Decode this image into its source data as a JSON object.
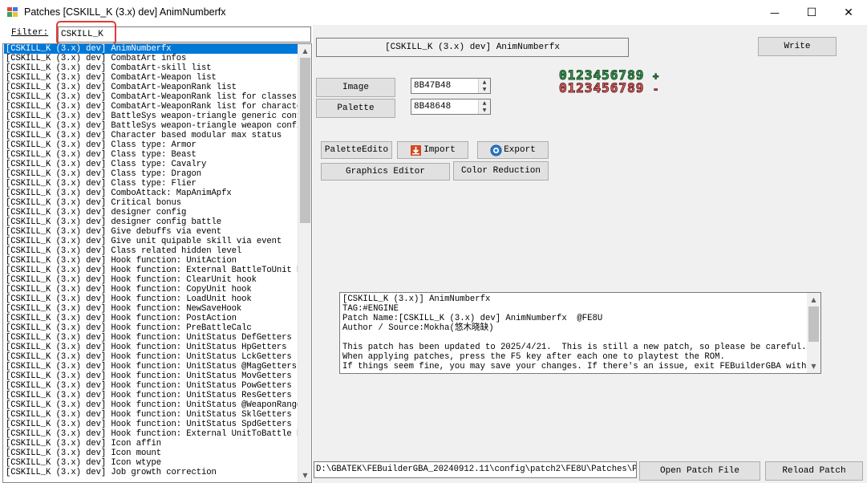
{
  "window": {
    "title": "Patches [CSKILL_K (3.x) dev] AnimNumberfx",
    "minimize": "—",
    "maximize": "☐",
    "close": "✕"
  },
  "filter": {
    "label": "Filter:",
    "value": "CSKILL_K"
  },
  "patch_list": [
    "[CSKILL_K (3.x) dev] AnimNumberfx",
    "[CSKILL_K (3.x) dev] CombatArt infos",
    "[CSKILL_K (3.x) dev] CombatArt-skill list",
    "[CSKILL_K (3.x) dev] CombatArt-Weapon list",
    "[CSKILL_K (3.x) dev] CombatArt-WeaponRank list",
    "[CSKILL_K (3.x) dev] CombatArt-WeaponRank list for classes",
    "[CSKILL_K (3.x) dev] CombatArt-WeaponRank list for characters",
    "[CSKILL_K (3.x) dev] BattleSys weapon-triangle generic config",
    "[CSKILL_K (3.x) dev] BattleSys weapon-triangle weapon configs",
    "[CSKILL_K (3.x) dev] Character based modular max status",
    "[CSKILL_K (3.x) dev] Class type: Armor",
    "[CSKILL_K (3.x) dev] Class type: Beast",
    "[CSKILL_K (3.x) dev] Class type: Cavalry",
    "[CSKILL_K (3.x) dev] Class type: Dragon",
    "[CSKILL_K (3.x) dev] Class type: Flier",
    "[CSKILL_K (3.x) dev] ComboAttack: MapAnimApfx",
    "[CSKILL_K (3.x) dev] Critical bonus",
    "[CSKILL_K (3.x) dev] designer config",
    "[CSKILL_K (3.x) dev] designer config battle",
    "[CSKILL_K (3.x) dev] Give debuffs via event",
    "[CSKILL_K (3.x) dev] Give unit quipable skill via event",
    "[CSKILL_K (3.x) dev] Class related hidden level",
    "[CSKILL_K (3.x) dev] Hook function: UnitAction",
    "[CSKILL_K (3.x) dev] Hook function: External BattleToUnit hoo",
    "[CSKILL_K (3.x) dev] Hook function: ClearUnit hook",
    "[CSKILL_K (3.x) dev] Hook function: CopyUnit hook",
    "[CSKILL_K (3.x) dev] Hook function: LoadUnit hook",
    "[CSKILL_K (3.x) dev] Hook function: NewSaveHook",
    "[CSKILL_K (3.x) dev] Hook function: PostAction",
    "[CSKILL_K (3.x) dev] Hook function: PreBattleCalc",
    "[CSKILL_K (3.x) dev] Hook function: UnitStatus DefGetters",
    "[CSKILL_K (3.x) dev] Hook function: UnitStatus HpGetters",
    "[CSKILL_K (3.x) dev] Hook function: UnitStatus LckGetters",
    "[CSKILL_K (3.x) dev] Hook function: UnitStatus @MagGetters",
    "[CSKILL_K (3.x) dev] Hook function: UnitStatus MovGetters",
    "[CSKILL_K (3.x) dev] Hook function: UnitStatus PowGetters",
    "[CSKILL_K (3.x) dev] Hook function: UnitStatus ResGetters",
    "[CSKILL_K (3.x) dev] Hook function: UnitStatus @WeaponRangeGe",
    "[CSKILL_K (3.x) dev] Hook function: UnitStatus SklGetters",
    "[CSKILL_K (3.x) dev] Hook function: UnitStatus SpdGetters",
    "[CSKILL_K (3.x) dev] Hook function: External UnitToBattle hoo",
    "[CSKILL_K (3.x) dev] Icon affin",
    "[CSKILL_K (3.x) dev] Icon mount",
    "[CSKILL_K (3.x) dev] Icon wtype",
    "[CSKILL_K (3.x) dev] Job growth correction"
  ],
  "patch_header": "[CSKILL_K (3.x) dev] AnimNumberfx",
  "buttons": {
    "write": "Write",
    "image": "Image",
    "palette": "Palette",
    "palette_editor": "PaletteEdito",
    "import": "Import",
    "export": "Export",
    "graphics_editor": "Graphics Editor",
    "color_reduction": "Color Reduction",
    "open_patch_file": "Open Patch File",
    "reload_patch": "Reload Patch"
  },
  "fields": {
    "image_address": "8B47B48",
    "palette_address": "8B48648"
  },
  "preview": {
    "green_digits": "0123456789",
    "green_sign": "+",
    "red_digits": "0123456789",
    "red_sign": "-"
  },
  "description": "[CSKILL_K (3.x)] AnimNumberfx\nTAG:#ENGINE\nPatch Name:[CSKILL_K (3.x) dev] AnimNumberfx  @FE8U\nAuthor / Source:Mokha(悠木晓缺)\n\nThis patch has been updated to 2025/4/21.  This is still a new patch, so please be careful.\nWhen applying patches, press the F5 key after each one to playtest the ROM.\nIf things seem fine, you may save your changes. If there's an issue, exit FEBuilderGBA without",
  "patch_path": "D:\\GBATEK\\FEBuilderGBA_20240912.11\\config\\patch2\\FE8U\\Patches\\PATCH",
  "colors": {
    "selection": "#0078d7",
    "highlight_box": "#e53935",
    "panel_bg": "#f0f0f0"
  }
}
